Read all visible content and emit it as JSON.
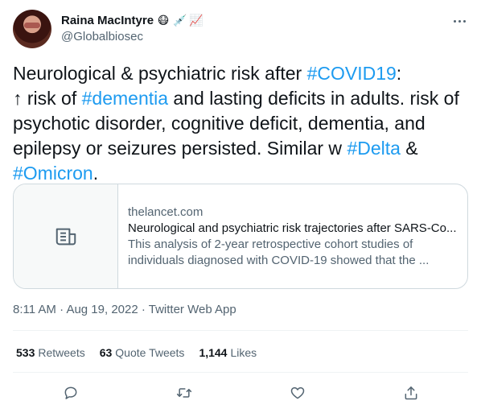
{
  "author": {
    "display_name": "Raina MacIntyre",
    "emojis": [
      "😷",
      "💉",
      "📈"
    ],
    "handle": "@Globalbiosec"
  },
  "tweet": {
    "line1_pre": "Neurological & psychiatric risk after ",
    "hashtag_covid": "#COVID19",
    "line1_post": ":",
    "line2_pre": "↑ risk of ",
    "hashtag_dementia": "#dementia",
    "line2_post": " and lasting deficits in adults. risk of psychotic disorder, cognitive deficit, dementia, and epilepsy or seizures persisted. Similar w ",
    "hashtag_delta": "#Delta",
    "amp": " &",
    "hashtag_omicron": "#Omicron",
    "end": "."
  },
  "link_card": {
    "domain": "thelancet.com",
    "title": "Neurological and psychiatric risk trajectories after SARS-Co...",
    "description": "This analysis of 2-year retrospective cohort studies of individuals diagnosed with COVID-19 showed that the ...",
    "icon": "document-icon"
  },
  "meta": {
    "time": "8:11 AM",
    "date": "Aug 19, 2022",
    "source": "Twitter Web App",
    "separator": " · "
  },
  "stats": {
    "retweets_count": "533",
    "retweets_label": "Retweets",
    "quotes_count": "63",
    "quotes_label": "Quote Tweets",
    "likes_count": "1,144",
    "likes_label": "Likes"
  },
  "colors": {
    "link": "#1d9bf0",
    "secondary_text": "#536471",
    "primary_text": "#0f1419",
    "border": "#cfd9de"
  }
}
